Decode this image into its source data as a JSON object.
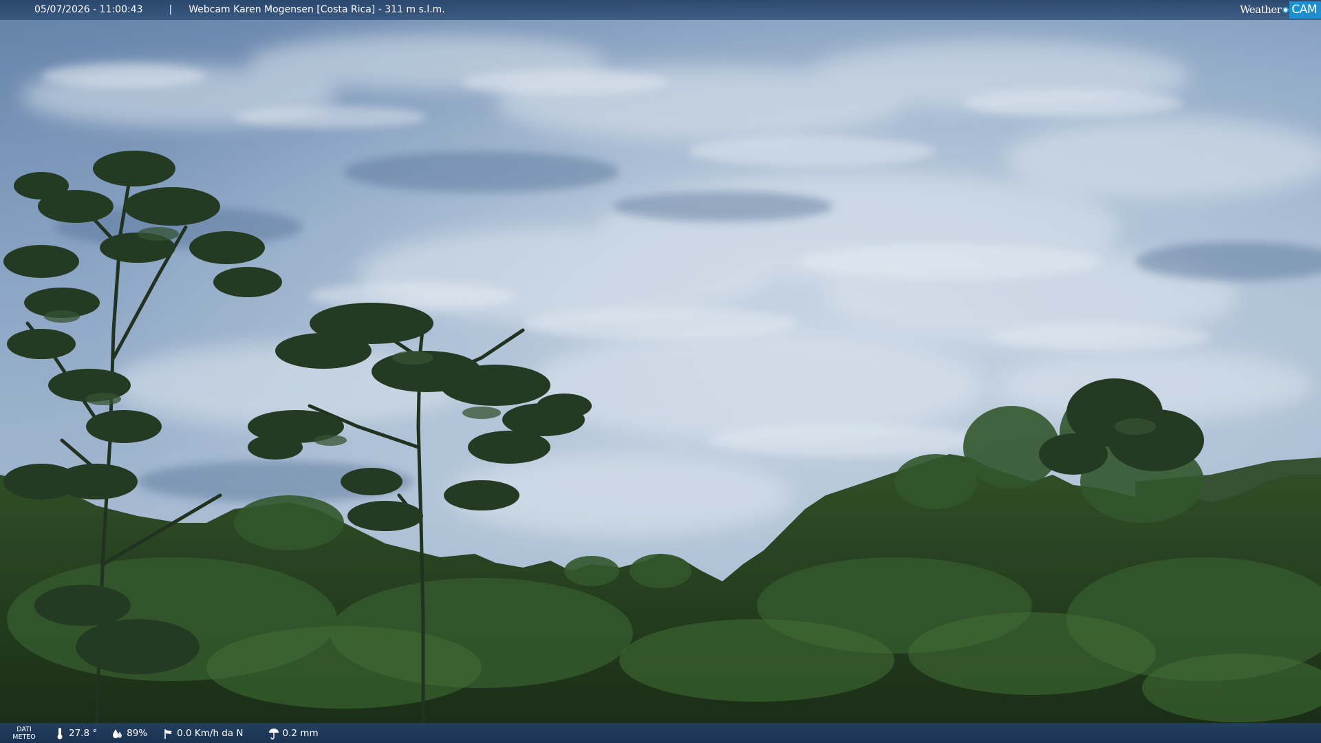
{
  "header": {
    "timestamp": "05/07/2026 - 11:00:43",
    "separator": "|",
    "title": "Webcam Karen Mogensen [Costa Rica]  - 311 m s.l.m."
  },
  "brand": {
    "part1": "Weather",
    "part2": "CAM",
    "accent": "#1b8fd0"
  },
  "weather": {
    "label_line1": "DATI",
    "label_line2": "METEO",
    "temperature": "27.8 °",
    "humidity": "89%",
    "wind": "0.0 Km/h da N",
    "rain": "0.2 mm"
  },
  "icons": {
    "temperature": "thermometer-icon",
    "humidity": "water-drops-icon",
    "wind": "wind-vane-icon",
    "rain": "rain-gauge-icon"
  },
  "colors": {
    "bar": "#274a74",
    "sky": "#8fa8c4",
    "foliage": "#1f3a17"
  }
}
